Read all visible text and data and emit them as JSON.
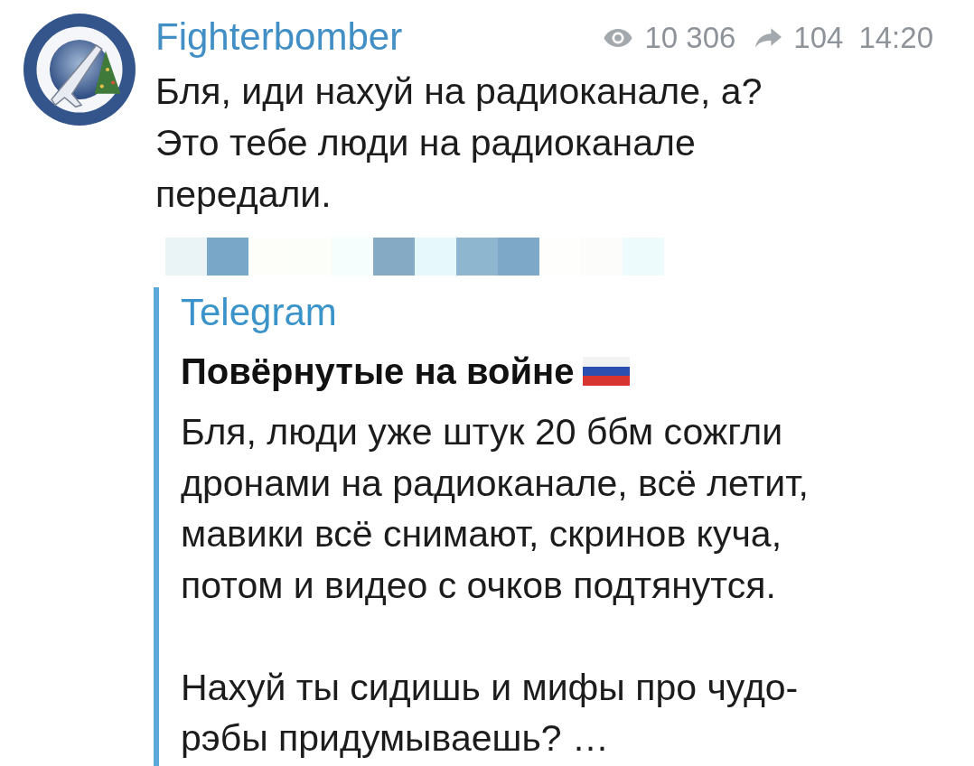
{
  "post": {
    "channel_name": "Fighterbomber",
    "views": "10 306",
    "forwards": "104",
    "time": "14:20",
    "text": "Бля, иди нахуй на радиоканале, а?\nЭто тебе люди на радиоканале передали."
  },
  "quote": {
    "source": "Telegram",
    "title": "Повёрнутые на войне",
    "text": "Бля, люди уже штук 20 ббм сожгли дронами на радиоканале, всё летит, мавики всё снимают, скринов куча, потом и видео с очков подтянутся.\n\nНахуй ты сидишь и мифы про чудо-рэбы придумываешь? …"
  }
}
